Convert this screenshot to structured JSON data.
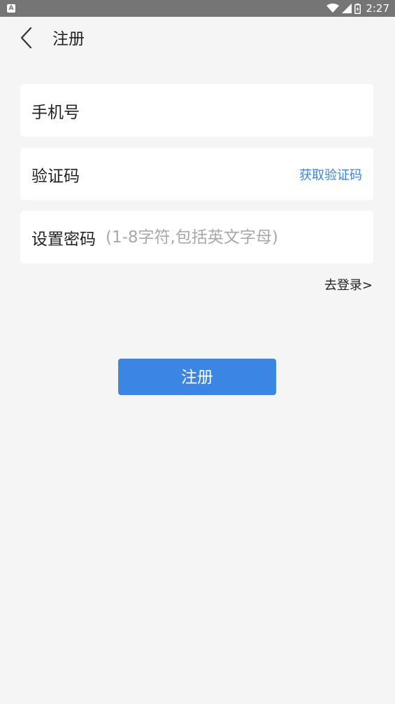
{
  "status_bar": {
    "app_icon_glyph": "A",
    "time": "2:27",
    "icons": [
      "wifi-icon",
      "signal-icon",
      "battery-icon"
    ],
    "background": "#757575"
  },
  "header": {
    "title": "注册",
    "back_icon": "chevron-left-icon"
  },
  "form": {
    "phone": {
      "label": "手机号",
      "value": "",
      "placeholder": ""
    },
    "code": {
      "label": "验证码",
      "value": "",
      "placeholder": "",
      "action_label": "获取验证码"
    },
    "password": {
      "label": "设置密码",
      "value": "",
      "placeholder": "(1-8字符,包括英文字母)"
    }
  },
  "login_link": "去登录>",
  "register_button": "注册",
  "colors": {
    "accent": "#3b86e5",
    "link": "#3b86e0",
    "background": "#f5f5f5",
    "field_background": "#ffffff"
  }
}
